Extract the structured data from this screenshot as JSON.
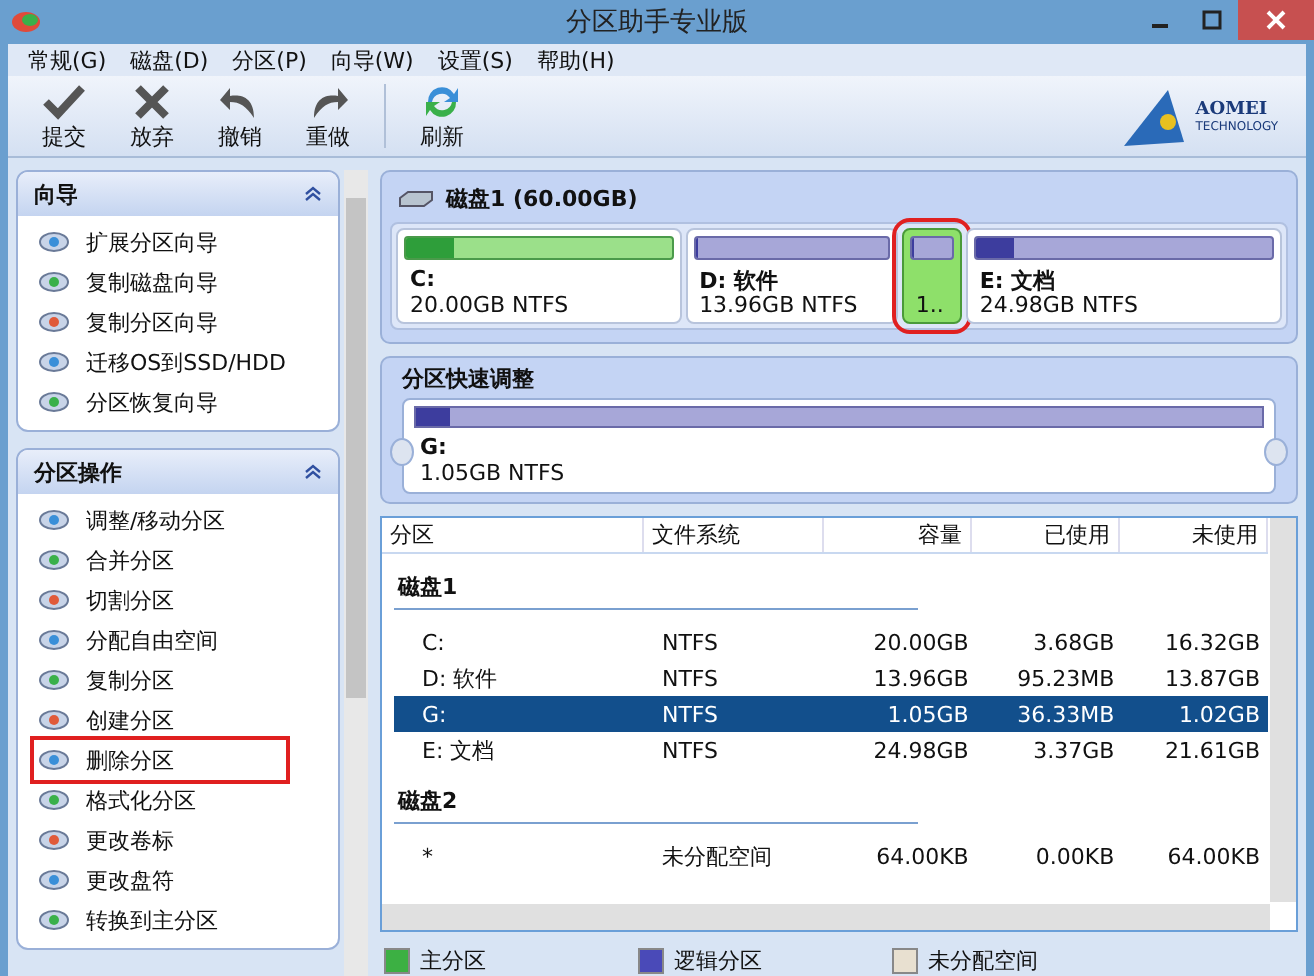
{
  "window": {
    "title": "分区助手专业版"
  },
  "menu": [
    "常规(G)",
    "磁盘(D)",
    "分区(P)",
    "向导(W)",
    "设置(S)",
    "帮助(H)"
  ],
  "toolbar": [
    {
      "label": "提交",
      "kind": "check"
    },
    {
      "label": "放弃",
      "kind": "cross"
    },
    {
      "label": "撤销",
      "kind": "undo"
    },
    {
      "label": "重做",
      "kind": "redo"
    },
    {
      "label": "刷新",
      "kind": "refresh"
    }
  ],
  "logo": {
    "name": "AOMEI",
    "sub": "TECHNOLOGY"
  },
  "sidebar": [
    {
      "title": "向导",
      "expanded": true,
      "items": [
        {
          "label": "扩展分区向导",
          "highlighted": false
        },
        {
          "label": "复制磁盘向导",
          "highlighted": false
        },
        {
          "label": "复制分区向导",
          "highlighted": false
        },
        {
          "label": "迁移OS到SSD/HDD",
          "highlighted": false
        },
        {
          "label": "分区恢复向导",
          "highlighted": false
        }
      ]
    },
    {
      "title": "分区操作",
      "expanded": true,
      "items": [
        {
          "label": "调整/移动分区",
          "highlighted": false
        },
        {
          "label": "合并分区",
          "highlighted": false
        },
        {
          "label": "切割分区",
          "highlighted": false
        },
        {
          "label": "分配自由空间",
          "highlighted": false
        },
        {
          "label": "复制分区",
          "highlighted": false
        },
        {
          "label": "创建分区",
          "highlighted": false
        },
        {
          "label": "删除分区",
          "highlighted": true
        },
        {
          "label": "格式化分区",
          "highlighted": false
        },
        {
          "label": "更改卷标",
          "highlighted": false
        },
        {
          "label": "更改盘符",
          "highlighted": false
        },
        {
          "label": "转换到主分区",
          "highlighted": false
        }
      ]
    }
  ],
  "disk_map": {
    "title": "磁盘1 (60.00GB)",
    "partitions": [
      {
        "name": "C:",
        "info": "20.00GB NTFS",
        "kind": "primary",
        "level": 0.18,
        "selected": false,
        "highlighted": false
      },
      {
        "name": "D: 软件",
        "info": "13.96GB NTFS",
        "kind": "logical",
        "level": 0.01,
        "selected": false,
        "highlighted": false
      },
      {
        "info": "1..",
        "kind": "logical",
        "level": 0.03,
        "selected": true,
        "highlighted": true
      },
      {
        "name": "E: 文档",
        "info": "24.98GB NTFS",
        "kind": "logical",
        "level": 0.13,
        "selected": false,
        "highlighted": false
      }
    ]
  },
  "quick_adjust": {
    "title": "分区快速调整",
    "name": "G:",
    "info": "1.05GB NTFS",
    "level": 0.04
  },
  "table": {
    "columns": [
      "分区",
      "文件系统",
      "容量",
      "已使用",
      "未使用"
    ],
    "groups": [
      {
        "title": "磁盘1",
        "rows": [
          {
            "cells": [
              "C:",
              "NTFS",
              "20.00GB",
              "3.68GB",
              "16.32GB"
            ],
            "selected": false
          },
          {
            "cells": [
              "D: 软件",
              "NTFS",
              "13.96GB",
              "95.23MB",
              "13.87GB"
            ],
            "selected": false
          },
          {
            "cells": [
              "G:",
              "NTFS",
              "1.05GB",
              "36.33MB",
              "1.02GB"
            ],
            "selected": true
          },
          {
            "cells": [
              "E: 文档",
              "NTFS",
              "24.98GB",
              "3.37GB",
              "21.61GB"
            ],
            "selected": false
          }
        ]
      },
      {
        "title": "磁盘2",
        "rows": [
          {
            "cells": [
              "*",
              "未分配空间",
              "64.00KB",
              "0.00KB",
              "64.00KB"
            ],
            "selected": false
          }
        ]
      }
    ]
  },
  "legend": [
    {
      "label": "主分区",
      "color": "#3cb043"
    },
    {
      "label": "逻辑分区",
      "color": "#4a4ab8"
    },
    {
      "label": "未分配空间",
      "color": "#e8e0d0"
    }
  ]
}
